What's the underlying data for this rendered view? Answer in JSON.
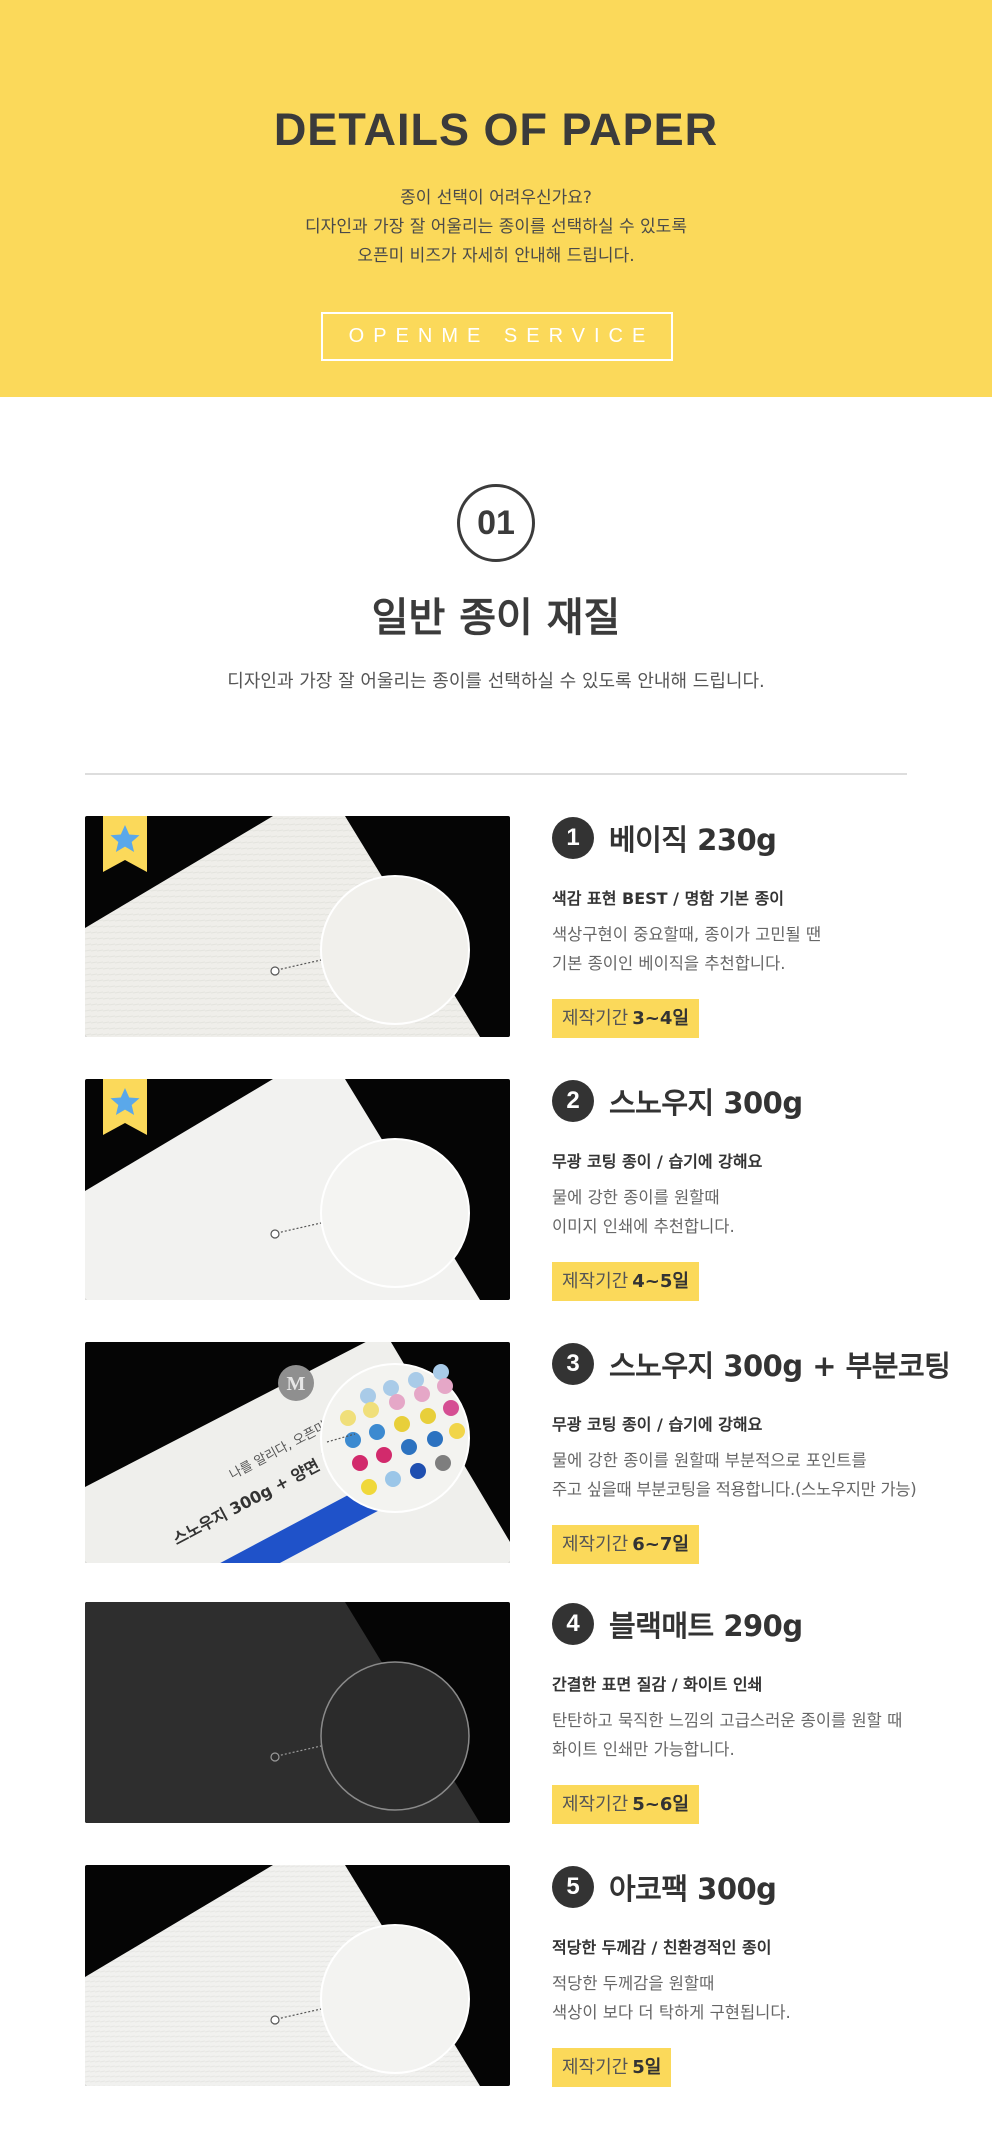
{
  "header": {
    "title": "DETAILS OF PAPER",
    "lines": [
      "종이 선택이 어려우신가요?",
      "디자인과 가장 잘 어울리는 종이를 선택하실 수 있도록",
      "오픈미 비즈가 자세히 안내해 드립니다."
    ],
    "button_label": "OPENME SERVICE"
  },
  "section": {
    "number": "01",
    "title": "일반 종이 재질",
    "subtitle": "디자인과 가장 잘 어울리는 종이를 선택하실 수 있도록 안내해 드립니다."
  },
  "papers": [
    {
      "number": "1",
      "name": "베이직 230g",
      "feature": "색감 표현 BEST / 명함 기본 종이",
      "desc": [
        "색상구현이 중요할때, 종이가 고민될 땐",
        "기본 종이인 베이직을 추천합니다."
      ],
      "lead_label": "제작기간",
      "lead_value": "3~4일",
      "best": true,
      "badge_icon": "star-icon"
    },
    {
      "number": "2",
      "name": "스노우지 300g",
      "feature": "무광 코팅 종이 / 습기에 강해요",
      "desc": [
        "물에 강한 종이를 원할때",
        "이미지 인쇄에 추천합니다."
      ],
      "lead_label": "제작기간",
      "lead_value": "4~5일",
      "best": true,
      "badge_icon": "star-icon"
    },
    {
      "number": "3",
      "name": "스노우지 300g + 부분코팅",
      "feature": "무광 코팅 종이 / 습기에 강해요",
      "desc": [
        "물에 강한 종이를 원할때 부분적으로 포인트를",
        "주고 싶을때 부분코팅을 적용합니다.(스노우지만 가능)"
      ],
      "lead_label": "제작기간",
      "lead_value": "6~7일",
      "best": false,
      "sample_card": {
        "line1": "나를 알리다, 오픈미",
        "line2": "스노우지 300g + 양면 부분코팅"
      }
    },
    {
      "number": "4",
      "name": "블랙매트 290g",
      "feature": "간결한 표면 질감 / 화이트 인쇄",
      "desc": [
        "탄탄하고 묵직한 느낌의 고급스러운 종이를 원할 때",
        "화이트 인쇄만 가능합니다."
      ],
      "lead_label": "제작기간",
      "lead_value": "5~6일",
      "best": false
    },
    {
      "number": "5",
      "name": "아코팩 300g",
      "feature": "적당한 두께감 / 친환경적인 종이",
      "desc": [
        "적당한 두께감을 원할때",
        "색상이 보다 더 탁하게 구현됩니다."
      ],
      "lead_label": "제작기간",
      "lead_value": "5일",
      "best": false
    }
  ],
  "colors": {
    "accent_yellow": "#fbd95a",
    "text_dark": "#333333",
    "badge_star": "#5aa8ea"
  }
}
